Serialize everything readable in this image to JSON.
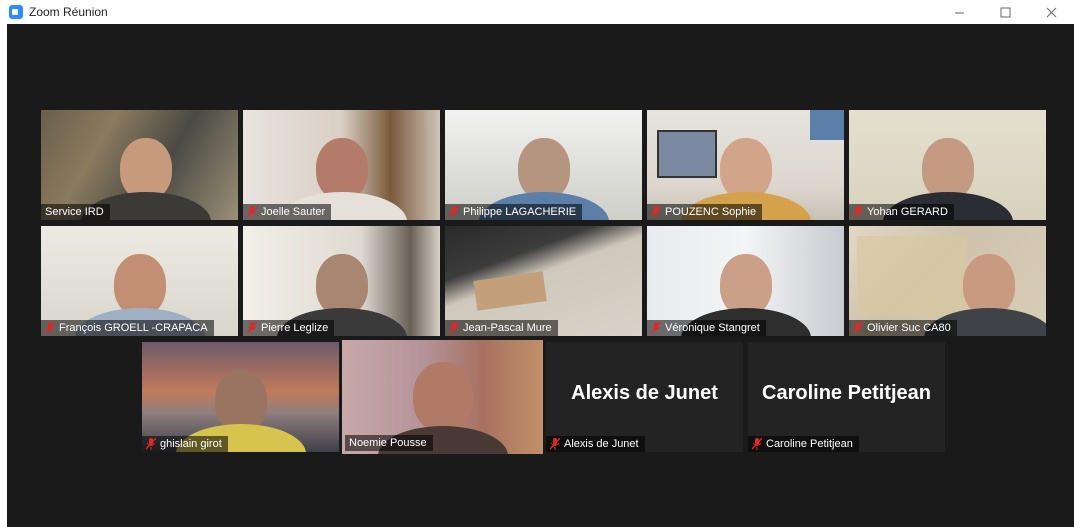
{
  "window": {
    "title": "Zoom Réunion"
  },
  "colors": {
    "stage": "#1a1a1a",
    "active_border": "#c6e27a",
    "mute_red": "#e02828"
  },
  "participants": [
    {
      "name": "Service IRD",
      "muted": false,
      "video": true
    },
    {
      "name": "Joelle Sauter",
      "muted": true,
      "video": true
    },
    {
      "name": "Philippe LAGACHERIE",
      "muted": true,
      "video": true
    },
    {
      "name": "POUZENC Sophie",
      "muted": true,
      "video": true
    },
    {
      "name": "Yohan GERARD",
      "muted": true,
      "video": true
    },
    {
      "name": "François GROELL -CRAPACA",
      "muted": true,
      "video": true
    },
    {
      "name": "Pierre Leglize",
      "muted": true,
      "video": true
    },
    {
      "name": "Jean-Pascal Mure",
      "muted": true,
      "video": true
    },
    {
      "name": "Véronique Stangret",
      "muted": true,
      "video": true
    },
    {
      "name": "Olivier Suc CA80",
      "muted": true,
      "video": true
    },
    {
      "name": "ghislain girot",
      "muted": true,
      "video": true
    },
    {
      "name": "Noemie Pousse",
      "muted": false,
      "video": true,
      "active": true
    },
    {
      "name": "Alexis de Junet",
      "muted": true,
      "video": false
    },
    {
      "name": "Caroline Petitjean",
      "muted": true,
      "video": false
    }
  ]
}
